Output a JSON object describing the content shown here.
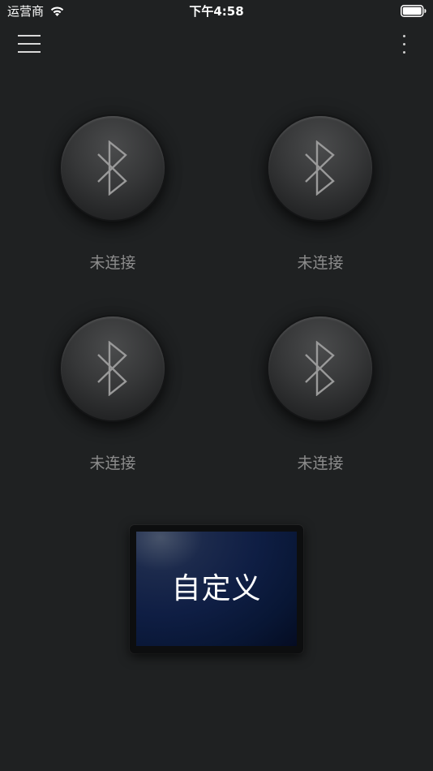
{
  "status_bar": {
    "carrier": "运营商",
    "time": "下午4:58",
    "wifi_icon": "wifi-icon",
    "battery_icon": "battery-icon"
  },
  "nav": {
    "menu_icon": "hamburger-menu-icon",
    "more_icon": "vertical-ellipsis-icon"
  },
  "devices": [
    {
      "icon": "bluetooth-icon",
      "status": "未连接"
    },
    {
      "icon": "bluetooth-icon",
      "status": "未连接"
    },
    {
      "icon": "bluetooth-icon",
      "status": "未连接"
    },
    {
      "icon": "bluetooth-icon",
      "status": "未连接"
    }
  ],
  "custom_button": {
    "label": "自定义"
  },
  "colors": {
    "background": "#1f2122",
    "status_text": "#8c8c8c",
    "custom_screen": "#0f1e44"
  }
}
